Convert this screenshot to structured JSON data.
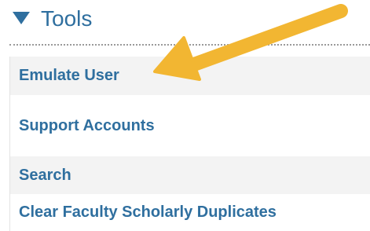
{
  "section": {
    "title": "Tools",
    "expanded": true,
    "caret_icon": "triangle-down-icon"
  },
  "menu": {
    "items": [
      {
        "label": "Emulate User"
      },
      {
        "label": "Support Accounts"
      },
      {
        "label": "Search"
      },
      {
        "label": "Clear Faculty Scholarly Duplicates"
      }
    ]
  },
  "annotation": {
    "icon": "arrow-pointer-icon",
    "color": "#f2b632",
    "points_to": "Emulate User"
  },
  "colors": {
    "link": "#2f6f9f",
    "row_alt": "#f3f3f3",
    "divider": "#9a9a9a"
  }
}
